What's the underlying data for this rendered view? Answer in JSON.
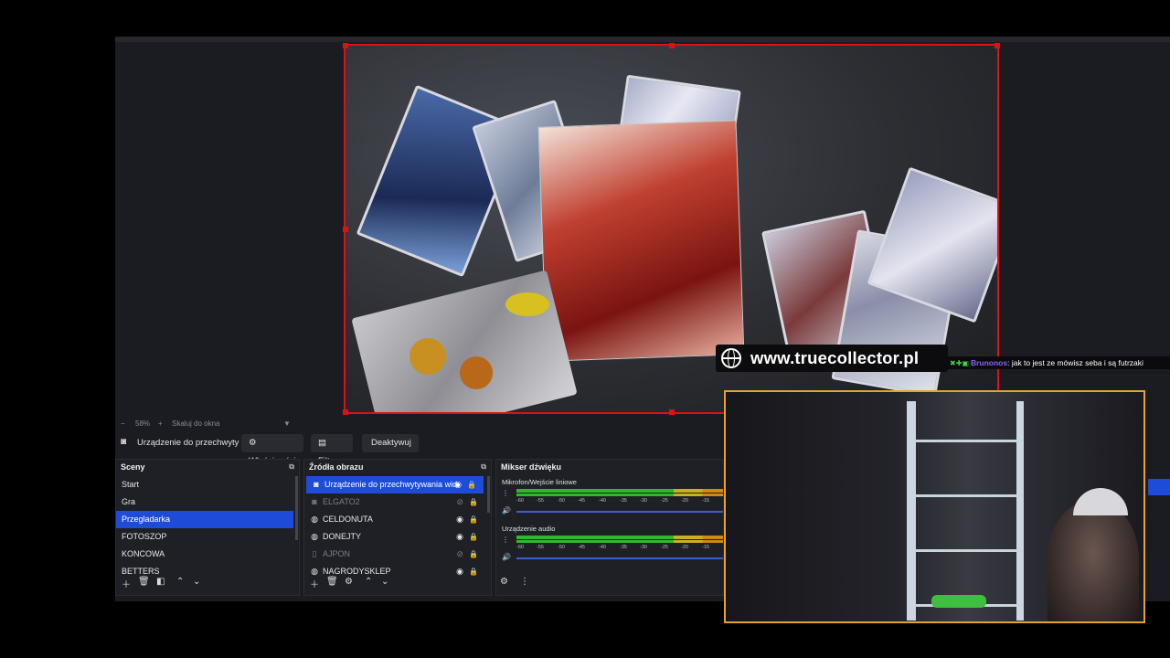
{
  "zoom": {
    "percent": "58%",
    "plus": "+",
    "fit_label": "Skaluj do okna",
    "dropdown": "▼"
  },
  "controls": {
    "source_name": "Urządzenie do przechwyty",
    "properties": "Właściwości",
    "filters": "Filtry",
    "deactivate": "Deaktywuj"
  },
  "scenes": {
    "title": "Sceny",
    "items": [
      "Start",
      "Gra",
      "Przegladarka",
      "FOTOSZOP",
      "KONCOWA",
      "BETTERS"
    ],
    "selected_index": 2
  },
  "sources": {
    "title": "Źródła obrazu",
    "items": [
      {
        "label": "Urządzenie do przechwytywania wid",
        "icon": "camera-icon",
        "visible": true,
        "selected": true
      },
      {
        "label": "ELGATO2",
        "icon": "camera-icon",
        "visible": false,
        "selected": false
      },
      {
        "label": "CELDONUTA",
        "icon": "globe-icon",
        "visible": true,
        "selected": false
      },
      {
        "label": "DONEJTY",
        "icon": "globe-icon",
        "visible": true,
        "selected": false
      },
      {
        "label": "AJPON",
        "icon": "file-icon",
        "visible": false,
        "selected": false
      },
      {
        "label": "NAGRODYSKLEP",
        "icon": "globe-icon",
        "visible": true,
        "selected": false
      }
    ]
  },
  "mixer": {
    "title": "Mikser dźwięku",
    "channels": [
      {
        "name": "Mikrofon/Wejście liniowe"
      },
      {
        "name": "Urządzenie audio"
      }
    ],
    "ticks": [
      "-60",
      "-55",
      "-50",
      "-45",
      "-40",
      "-35",
      "-30",
      "-25",
      "-20",
      "-15"
    ]
  },
  "overlay": {
    "url": "www.truecollector.pl",
    "chat_user": "Brunonos",
    "chat_message": ": jak to jest ze mówisz seba i są futrzaki"
  },
  "colors": {
    "selection": "#1e4cd8",
    "preview_border": "#e01010",
    "webcam_border": "#e8a030"
  }
}
